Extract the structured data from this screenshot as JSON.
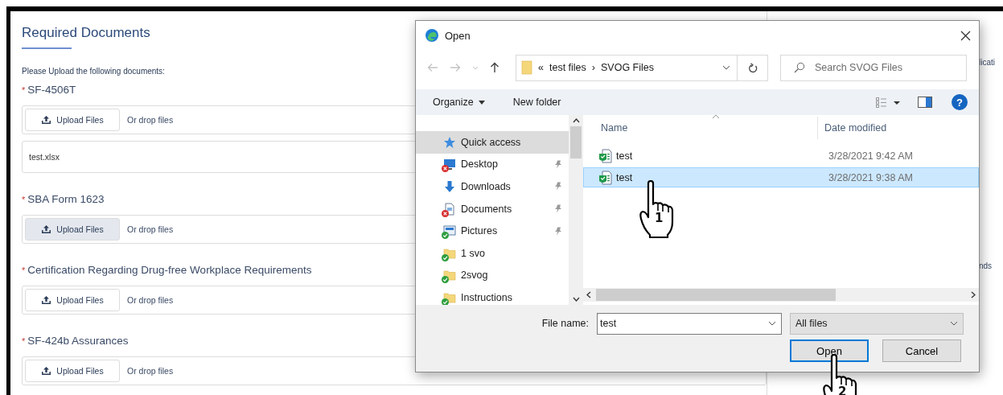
{
  "page": {
    "title": "Required Documents",
    "instructions": "Please Upload the following documents:",
    "documents": [
      {
        "label": "SF-4506T",
        "required_mark": "*",
        "button": "Upload Files",
        "button_hovered": false,
        "drop_hint": "Or drop files",
        "files": [
          "test.xlsx"
        ]
      },
      {
        "label": "SBA Form 1623",
        "required_mark": "*",
        "button": "Upload Files",
        "button_hovered": true,
        "drop_hint": "Or drop files"
      },
      {
        "label": "Certification Regarding Drug-free Workplace Requirements",
        "required_mark": "*",
        "button": "Upload Files",
        "button_hovered": false,
        "drop_hint": "Or drop files"
      },
      {
        "label": "SF-424b Assurances",
        "required_mark": "*",
        "button": "Upload Files",
        "button_hovered": false,
        "drop_hint": "Or drop files"
      }
    ]
  },
  "side_panel": {
    "texts": [
      "licati",
      "nds"
    ]
  },
  "dialog": {
    "title": "Open",
    "address": {
      "overflow": "«",
      "path": [
        "test files",
        "SVOG Files"
      ],
      "separator": "›"
    },
    "search": {
      "placeholder": "Search SVOG Files"
    },
    "toolbar": {
      "organize": "Organize",
      "new_folder": "New folder",
      "help": "?"
    },
    "nav_pane": [
      {
        "label": "Quick access",
        "kind": "star",
        "error": false,
        "synced": false,
        "pinned": false,
        "selected": true
      },
      {
        "label": "Desktop",
        "kind": "desktop",
        "error": true,
        "synced": false,
        "pinned": true,
        "selected": false
      },
      {
        "label": "Downloads",
        "kind": "download",
        "error": false,
        "synced": false,
        "pinned": true,
        "selected": false
      },
      {
        "label": "Documents",
        "kind": "document",
        "error": true,
        "synced": false,
        "pinned": true,
        "selected": false
      },
      {
        "label": "Pictures",
        "kind": "pictures",
        "error": false,
        "synced": true,
        "pinned": true,
        "selected": false
      },
      {
        "label": "1 svo",
        "kind": "folder",
        "error": false,
        "synced": true,
        "pinned": false,
        "selected": false
      },
      {
        "label": "2svog",
        "kind": "folder",
        "error": false,
        "synced": true,
        "pinned": false,
        "selected": false
      },
      {
        "label": "Instructions",
        "kind": "folder",
        "error": false,
        "synced": true,
        "pinned": false,
        "selected": false
      }
    ],
    "columns": [
      "Name",
      "Date modified"
    ],
    "files": [
      {
        "name": "test",
        "date": "3/28/2021 9:42 AM",
        "selected": false
      },
      {
        "name": "test",
        "date": "3/28/2021 9:38 AM",
        "selected": true
      }
    ],
    "file_name": {
      "label": "File name:",
      "value": "test"
    },
    "file_type": {
      "value": "All files"
    },
    "buttons": [
      {
        "label": "Open",
        "default": true
      },
      {
        "label": "Cancel",
        "default": false
      }
    ]
  },
  "annotations": [
    {
      "label": "1"
    },
    {
      "label": "2"
    }
  ]
}
